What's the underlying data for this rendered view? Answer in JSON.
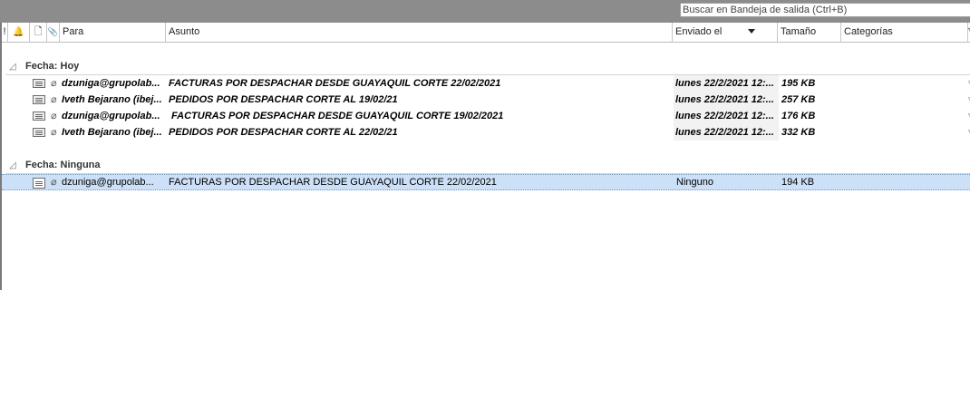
{
  "search": {
    "placeholder": "Buscar en Bandeja de salida (Ctrl+B)"
  },
  "columns": {
    "importance": "!",
    "reminder": "🔔",
    "type": "🗋",
    "attachment": "📎",
    "to": "Para",
    "subject": "Asunto",
    "sent": "Enviado el",
    "size": "Tamaño",
    "categories": "Categorías"
  },
  "groups": [
    {
      "label": "Fecha: Hoy",
      "rows": [
        {
          "to": "dzuniga@grupolab...",
          "subject": "FACTURAS POR DESPACHAR DESDE GUAYAQUIL CORTE 22/02/2021",
          "sent": "lunes 22/2/2021 12:...",
          "size": "195 KB",
          "unread": true
        },
        {
          "to": "Iveth Bejarano (ibej...",
          "subject": "PEDIDOS POR DESPACHAR CORTE AL 19/02/21",
          "sent": "lunes 22/2/2021 12:...",
          "size": "257 KB",
          "unread": true
        },
        {
          "to": "dzuniga@grupolab...",
          "subject": " FACTURAS POR DESPACHAR DESDE GUAYAQUIL CORTE 19/02/2021",
          "sent": "lunes 22/2/2021 12:...",
          "size": "176 KB",
          "unread": true
        },
        {
          "to": "Iveth Bejarano (ibej...",
          "subject": "PEDIDOS POR DESPACHAR CORTE AL 22/02/21",
          "sent": "lunes 22/2/2021 12:...",
          "size": "332 KB",
          "unread": true
        }
      ]
    },
    {
      "label": "Fecha: Ninguna",
      "rows": [
        {
          "to": "dzuniga@grupolab...",
          "subject": "FACTURAS POR DESPACHAR DESDE GUAYAQUIL CORTE 22/02/2021",
          "sent": "Ninguno",
          "size": "194 KB",
          "unread": false,
          "selected": true
        }
      ]
    }
  ]
}
